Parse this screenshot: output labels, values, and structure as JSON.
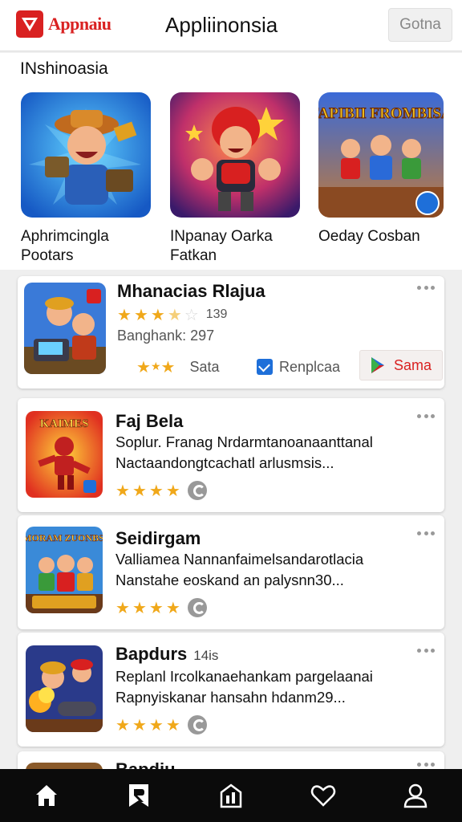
{
  "header": {
    "logo_text": "Appnaiu",
    "title": "Appliinonsia",
    "button_label": "Gotna"
  },
  "featured": {
    "section_label": "INshinoasia",
    "items": [
      {
        "name": "Aphrimcingla Pootars",
        "icon": "cartoon-hero-icon"
      },
      {
        "name": "INpanay Oarka Fatkan",
        "icon": "red-helmet-hero-icon"
      },
      {
        "name": "Oeday Cosban",
        "icon": "team-battle-icon",
        "art_text": "FAPIBII FROMBISA"
      }
    ]
  },
  "highlight": {
    "title": "Mhanacias Rlajua",
    "rating": 3.5,
    "rating_count": "139",
    "meta": "Banghank: 297",
    "star_label": "Sata",
    "secondary_label": "Renplcaa",
    "primary_label": "Sama"
  },
  "list": [
    {
      "title": "Faj Bela",
      "subtitle": "",
      "desc_line1": "Soplur. Franag Nrdarmtanoanaanttanal",
      "desc_line2": "Nactaandongtcachatl arlusmsis...",
      "rating": 4,
      "art_text": "KAIMES"
    },
    {
      "title": "Seidirgam",
      "subtitle": "",
      "desc_line1": "Valliamea Nannanfaimelsandarotlacia",
      "desc_line2": "Nanstahe eoskand an palysnn30...",
      "rating": 4,
      "art_text": "SMORAM ZUONBSA"
    },
    {
      "title": "Bapdurs",
      "subtitle": "14is",
      "desc_line1": "Replanl Ircolkanaehankam pargelaanai",
      "desc_line2": "Rapnyiskanar hansahn hdanm29...",
      "rating": 4,
      "art_text": ""
    }
  ],
  "partial_card": {
    "title": "Bapdiu"
  },
  "nav": [
    {
      "name": "home",
      "icon": "home-icon"
    },
    {
      "name": "library",
      "icon": "bookmark-icon"
    },
    {
      "name": "updates",
      "icon": "updates-icon"
    },
    {
      "name": "favorites",
      "icon": "heart-icon"
    },
    {
      "name": "profile",
      "icon": "person-icon"
    }
  ],
  "colors": {
    "brand": "#d92121",
    "star": "#f0a81a",
    "check": "#1e6fd9",
    "nav_bg": "#0b0b0b"
  }
}
